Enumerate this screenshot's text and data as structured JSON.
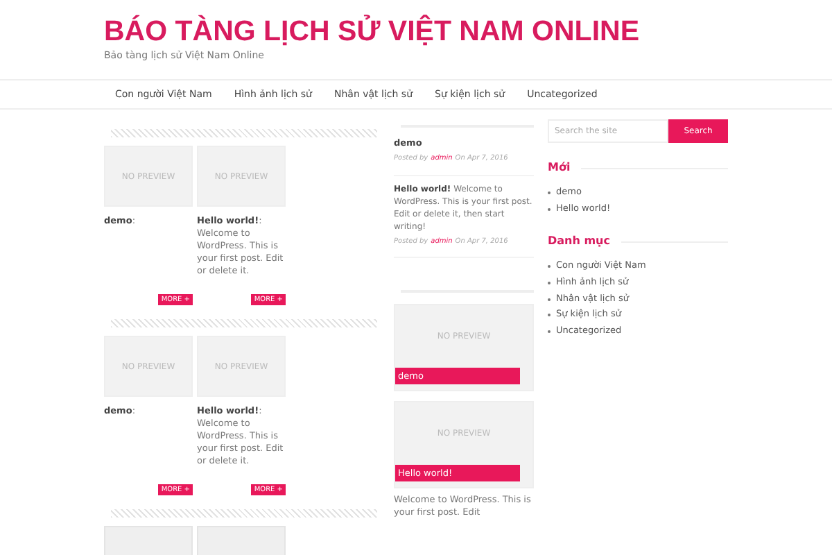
{
  "site_title": "BÁO TÀNG LỊCH SỬ VIỆT NAM ONLINE",
  "tagline": "Bảo tàng lịch sử Việt Nam Online",
  "nav": [
    "Con người Việt Nam",
    "Hình ảnh lịch sử",
    "Nhân vật lịch sử",
    "Sự kiện lịch sử",
    "Uncategorized"
  ],
  "grid_rows": [
    {
      "posts": [
        {
          "preview": "NO PREVIEW",
          "title": "demo",
          "colon": ":",
          "more": "MORE +"
        },
        {
          "preview": "NO PREVIEW",
          "title": "Hello world!",
          "colon": ":",
          "excerpt": "Welcome to WordPress. This is your first post. Edit or delete it.",
          "more": "MORE +"
        }
      ]
    },
    {
      "posts": [
        {
          "preview": "NO PREVIEW",
          "title": "demo",
          "colon": ":",
          "more": "MORE +"
        },
        {
          "preview": "NO PREVIEW",
          "title": "Hello world!",
          "colon": ":",
          "excerpt": "Welcome to WordPress. This is your first post. Edit or delete it.",
          "more": "MORE +"
        }
      ]
    },
    {
      "posts": [
        {
          "kind": "blank"
        },
        {
          "kind": "blank"
        }
      ]
    }
  ],
  "recent_posts": [
    {
      "title": "demo",
      "posted_by": "Posted by",
      "author": "admin",
      "date": "On Apr 7, 2016"
    },
    {
      "title": "Hello world!",
      "excerpt": "Welcome to WordPress. This is your first post. Edit or delete it, then start writing!",
      "posted_by": "Posted by",
      "author": "admin",
      "date": "On Apr 7, 2016"
    }
  ],
  "featured": [
    {
      "preview": "NO PREVIEW",
      "caption": "demo"
    },
    {
      "preview": "NO PREVIEW",
      "caption": "Hello world!",
      "excerpt": "Welcome to WordPress. This is your first post. Edit"
    }
  ],
  "search": {
    "placeholder": "Search the site",
    "button": "Search"
  },
  "widgets": [
    {
      "title": "Mới",
      "items": [
        "demo",
        "Hello world!"
      ]
    },
    {
      "title": "Danh mục",
      "items": [
        "Con người Việt Nam",
        "Hình ảnh lịch sử",
        "Nhân vật lịch sử",
        "Sự kiện lịch sử",
        "Uncategorized"
      ]
    }
  ]
}
